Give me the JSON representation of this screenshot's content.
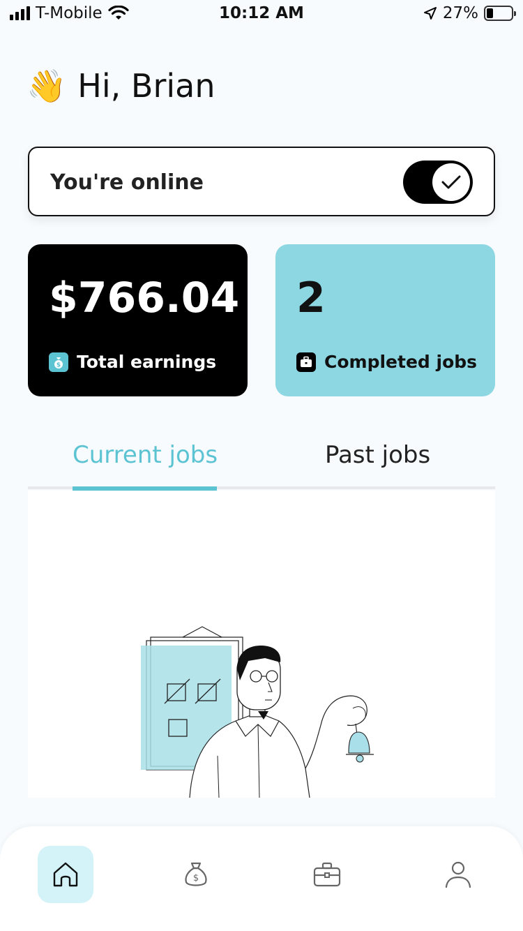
{
  "status_bar": {
    "carrier": "T-Mobile",
    "time": "10:12 AM",
    "battery_percent": "27%",
    "battery_level": 0.27
  },
  "greeting": {
    "emoji": "👋",
    "text": "Hi, Brian"
  },
  "online_status": {
    "label": "You're online",
    "toggle_on": true
  },
  "stats": {
    "earnings": {
      "value": "$766.04",
      "label": "Total earnings",
      "icon": "money-bag-icon"
    },
    "completed": {
      "value": "2",
      "label": "Completed jobs",
      "icon": "briefcase-icon"
    }
  },
  "tabs": [
    {
      "label": "Current jobs",
      "active": true
    },
    {
      "label": "Past jobs",
      "active": false
    }
  ],
  "bottom_nav": [
    {
      "name": "home",
      "icon": "home-icon",
      "active": true
    },
    {
      "name": "earnings",
      "icon": "money-bag-icon",
      "active": false
    },
    {
      "name": "jobs",
      "icon": "briefcase-icon",
      "active": false
    },
    {
      "name": "profile",
      "icon": "user-icon",
      "active": false
    }
  ],
  "colors": {
    "accent": "#5cc3d3",
    "card_light": "#8dd7e3",
    "nav_active_bg": "#d3f3f8",
    "background": "#f7fbfd"
  }
}
